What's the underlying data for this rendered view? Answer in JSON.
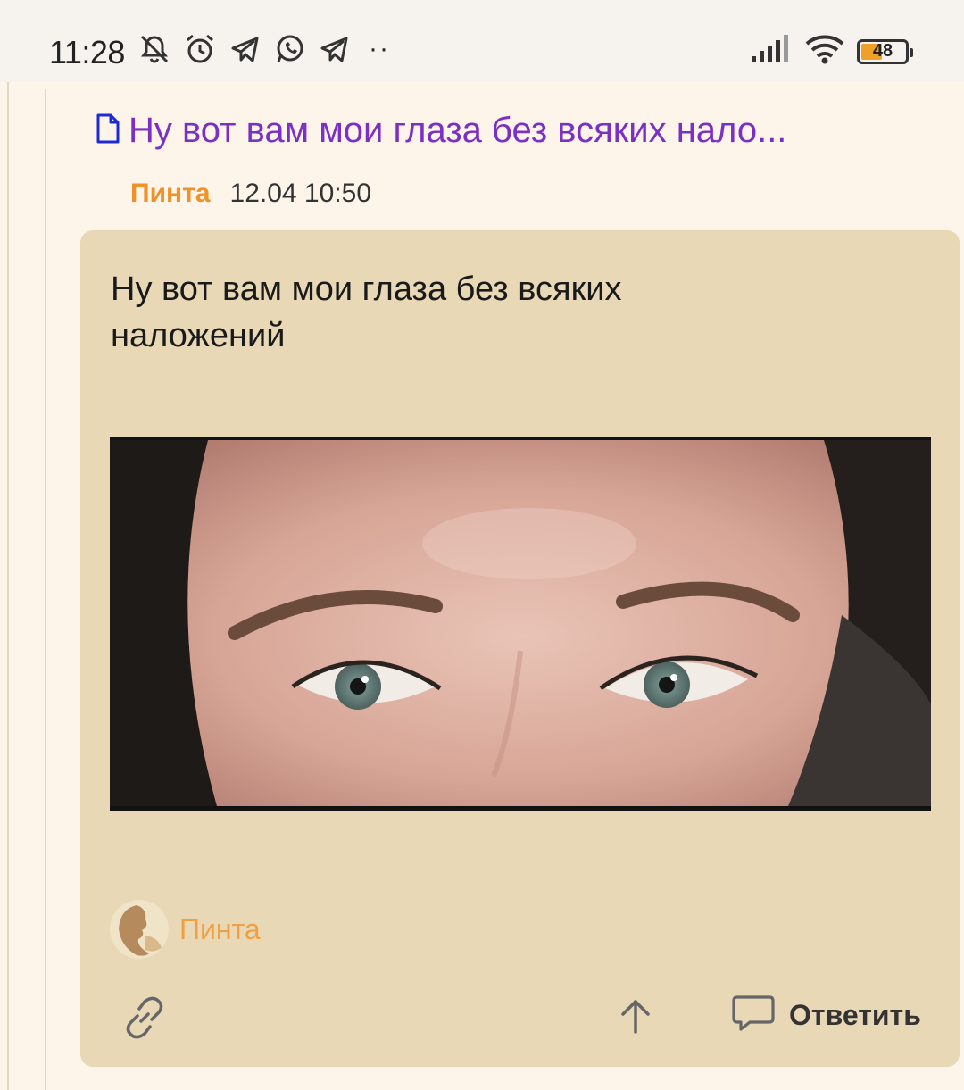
{
  "status_bar": {
    "time": "11:28",
    "battery_level": "48",
    "battery_fraction": 0.48,
    "left_icons": [
      "mute-bell-icon",
      "alarm-icon",
      "telegram-icon",
      "whatsapp-icon",
      "telegram-icon"
    ],
    "more_indicator": "··",
    "right_icons": [
      "signal-icon",
      "wifi-icon",
      "battery-icon"
    ]
  },
  "post": {
    "title": "Ну вот вам мои глаза без всяких нало...",
    "title_icon": "document-icon",
    "author": "Пинта",
    "date": "12.04 10:50",
    "body": "Ну вот вам мои глаза без всяких наложений",
    "image_alt": "close-up photo of eyes",
    "footer_author": "Пинта",
    "actions": {
      "link_icon": "link-icon",
      "up_icon": "arrow-up-icon",
      "reply_icon": "speech-bubble-icon",
      "reply_label": "Ответить"
    }
  },
  "colors": {
    "title": "#7a2fc7",
    "author": "#f0922a",
    "card_bg": "#e8d8b6",
    "page_bg": "#fdf5ea"
  }
}
